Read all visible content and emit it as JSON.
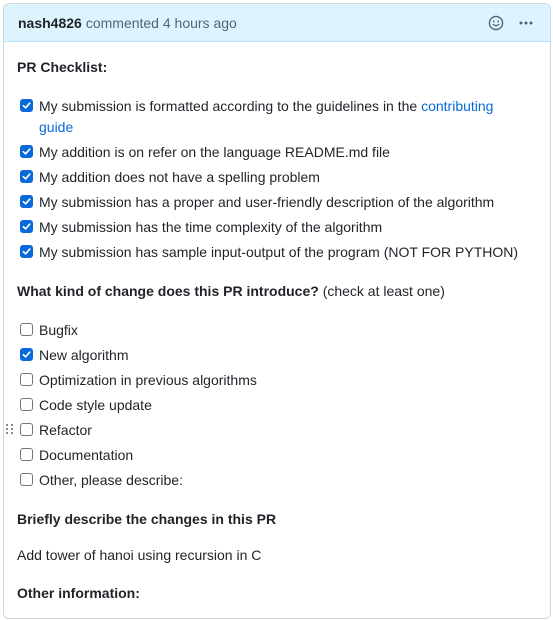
{
  "header": {
    "author": "nash4826",
    "action": "commented 4 hours ago",
    "emoji_icon": "smiley-icon",
    "more_icon": "kebab-horizontal-icon"
  },
  "checklist": {
    "heading": "PR Checklist:",
    "items": [
      {
        "checked": true,
        "text": "My submission is formatted according to the guidelines in the ",
        "link": "contributing guide"
      },
      {
        "checked": true,
        "text": "My addition is on refer on the language README.md file"
      },
      {
        "checked": true,
        "text": "My addition does not have a spelling problem"
      },
      {
        "checked": true,
        "text": "My submission has a proper and user-friendly description of the algorithm"
      },
      {
        "checked": true,
        "text": "My submission has the time complexity of the algorithm"
      },
      {
        "checked": true,
        "text": "My submission has sample input-output of the program (NOT FOR PYTHON)"
      }
    ]
  },
  "change_type": {
    "heading": "What kind of change does this PR introduce?",
    "heading_note": "(check at least one)",
    "items": [
      {
        "checked": false,
        "text": "Bugfix"
      },
      {
        "checked": true,
        "text": "New algorithm"
      },
      {
        "checked": false,
        "text": "Optimization in previous algorithms"
      },
      {
        "checked": false,
        "text": "Code style update"
      },
      {
        "checked": false,
        "text": "Refactor"
      },
      {
        "checked": false,
        "text": "Documentation"
      },
      {
        "checked": false,
        "text": "Other, please describe:"
      }
    ]
  },
  "description": {
    "heading": "Briefly describe the changes in this PR",
    "text": "Add tower of hanoi using recursion in C"
  },
  "other": {
    "heading": "Other information:"
  },
  "colors": {
    "accent": "#0969da",
    "header_bg": "#ddf4ff"
  }
}
